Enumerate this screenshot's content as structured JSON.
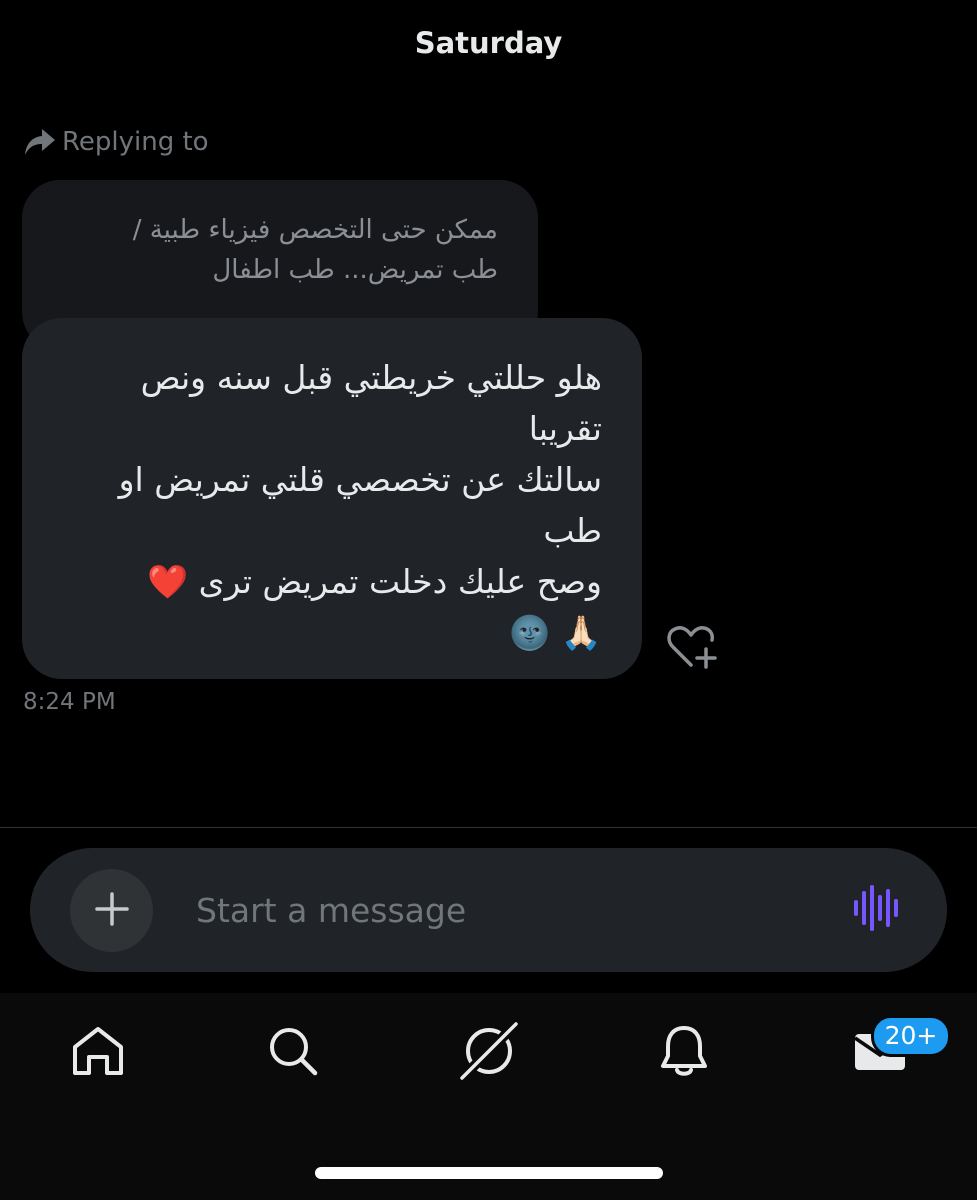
{
  "header": {
    "day": "Saturday"
  },
  "reply": {
    "icon": "reply-arrow-icon",
    "label": "Replying to",
    "quoted_text": "ممكن حتى التخصص فيزياء طبية /\nطب تمريض... طب اطفال"
  },
  "message": {
    "text": "هلو حللتي خريطتي قبل  سنه ونص\nتقريبا\nسالتك عن تخصصي قلتي تمريض او\nطب\nوصح عليك دخلت تمريض ترى ❤️\n🙏🏻 🌚",
    "time": "8:24 PM",
    "react_icon": "heart-plus-icon"
  },
  "composer": {
    "placeholder": "Start a message",
    "add_icon": "plus-icon",
    "voice_icon": "voice-wave-icon"
  },
  "nav": {
    "items": [
      {
        "name": "home",
        "icon": "home-icon"
      },
      {
        "name": "search",
        "icon": "search-icon"
      },
      {
        "name": "grok",
        "icon": "grok-icon"
      },
      {
        "name": "notifications",
        "icon": "bell-icon"
      },
      {
        "name": "messages",
        "icon": "mail-icon"
      }
    ],
    "messages_badge": "20+"
  },
  "colors": {
    "background": "#000000",
    "bubble": "#202327",
    "quoted_bubble": "#16181c",
    "muted_text": "#71767b",
    "accent": "#1d9bf0",
    "voice": "#7856ff"
  }
}
